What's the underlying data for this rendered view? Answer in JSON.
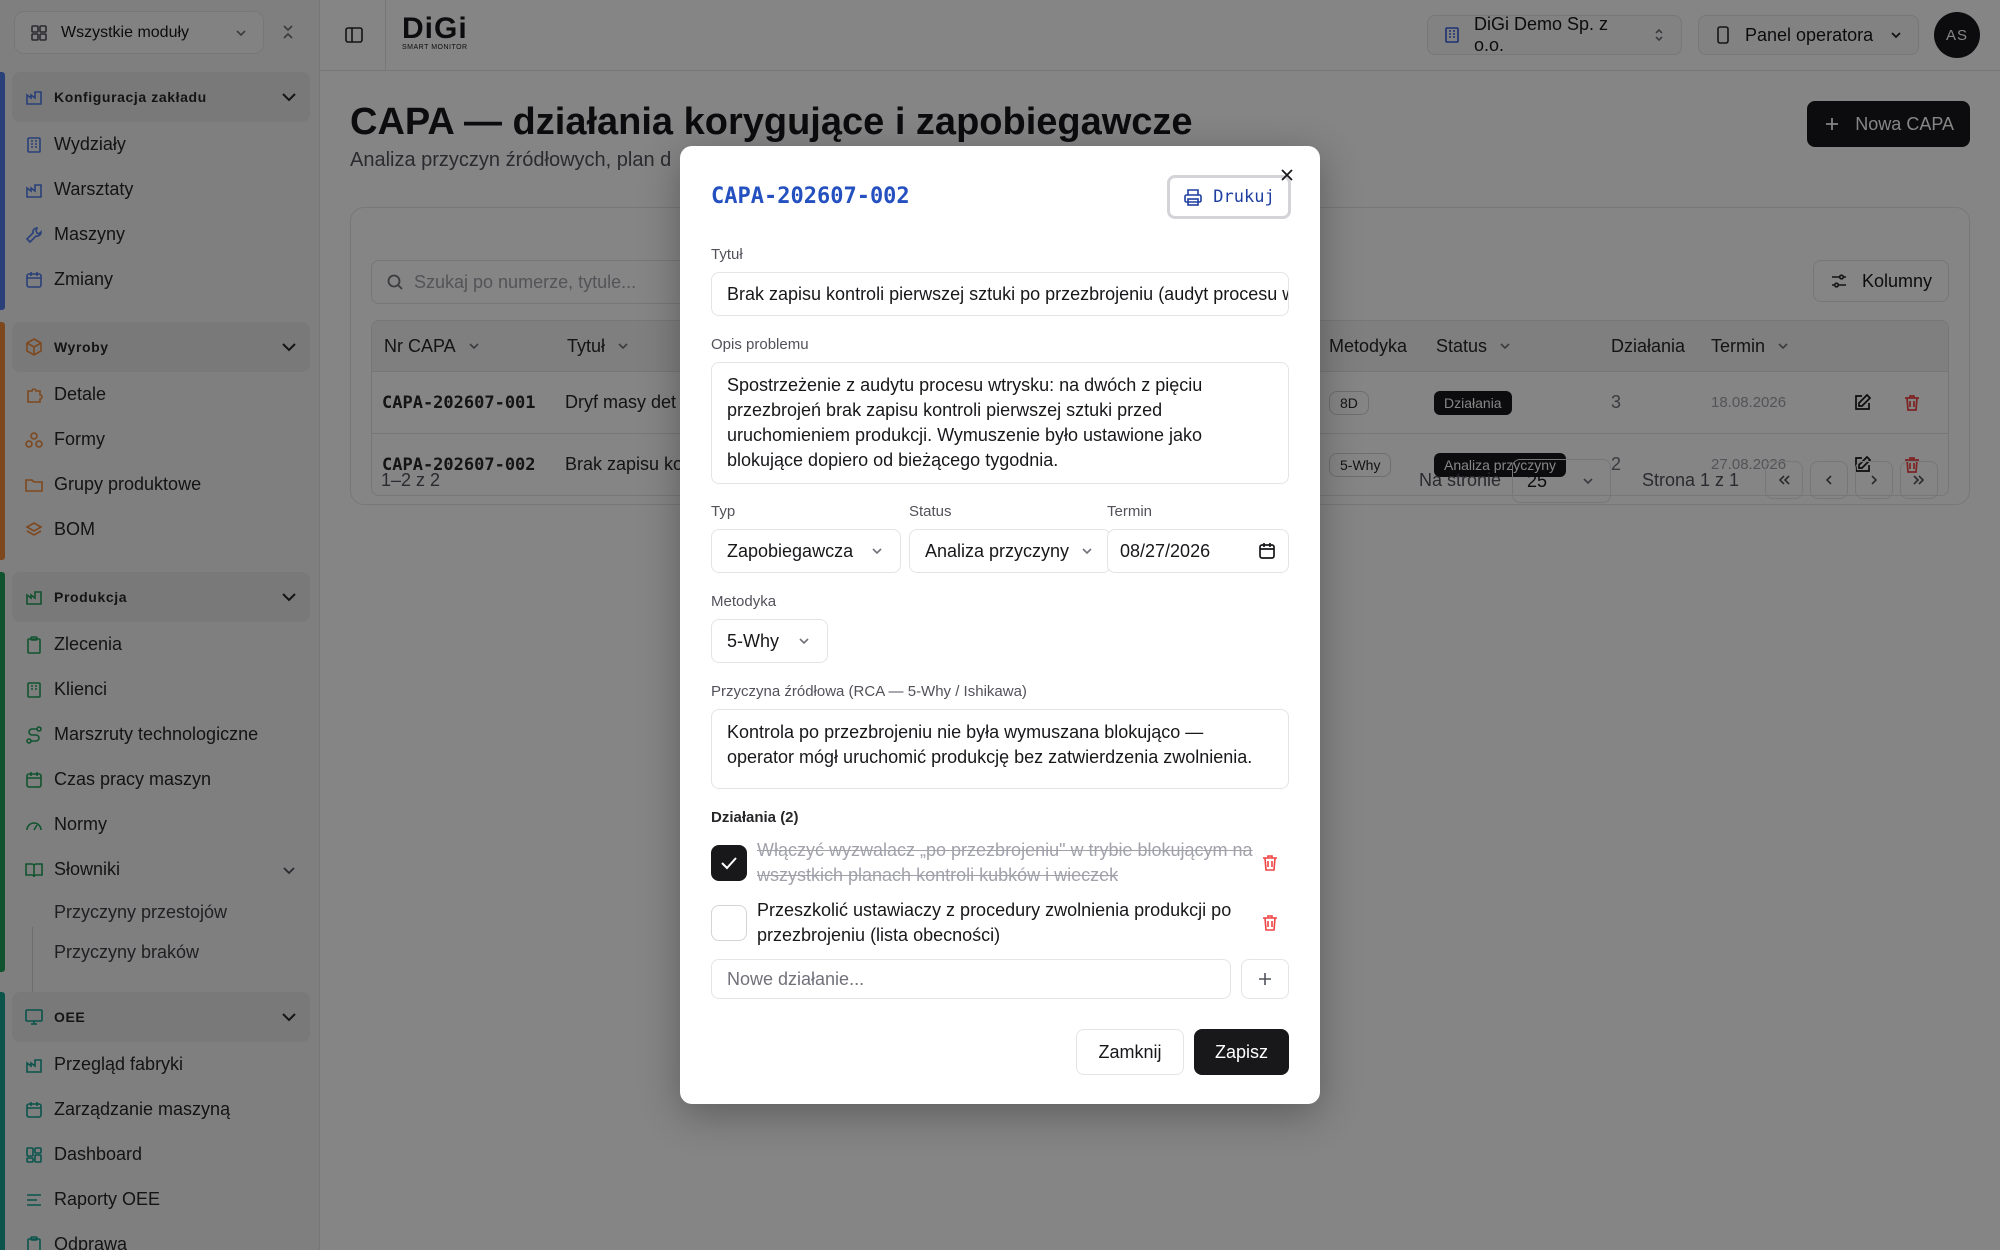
{
  "sidebar": {
    "module_selector": "Wszystkie moduły",
    "groups": [
      {
        "title": "Konfiguracja zakładu",
        "color": "#4f7be8",
        "items": [
          "Wydziały",
          "Warsztaty",
          "Maszyny",
          "Zmiany"
        ]
      },
      {
        "title": "Wyroby",
        "color": "#f08a3a",
        "items": [
          "Detale",
          "Formy",
          "Grupy produktowe",
          "BOM"
        ]
      },
      {
        "title": "Produkcja",
        "color": "#22a05a",
        "items": [
          "Zlecenia",
          "Klienci",
          "Marszruty technologiczne",
          "Czas pracy maszyn",
          "Normy",
          "Słowniki"
        ],
        "subitems": [
          "Przyczyny przestojów",
          "Przyczyny braków"
        ]
      },
      {
        "title": "OEE",
        "color": "#16a090",
        "items": [
          "Przegląd fabryki",
          "Zarządzanie maszyną",
          "Dashboard",
          "Raporty OEE",
          "Odprawa"
        ]
      }
    ]
  },
  "topbar": {
    "logo": "DiGi",
    "logo_sub": "SMART MONITOR",
    "company": "DiGi Demo Sp. z o.o.",
    "panel": "Panel operatora",
    "avatar": "AS"
  },
  "page": {
    "title": "CAPA — działania korygujące i zapobiegawcze",
    "subtitle": "Analiza przyczyn źródłowych, plan d",
    "new_button": "Nowa CAPA",
    "search_placeholder": "Szukaj po numerze, tytule...",
    "columns_button": "Kolumny",
    "table": {
      "headers": {
        "nr": "Nr CAPA",
        "title": "Tytuł",
        "method": "Metodyka",
        "status": "Status",
        "actions": "Działania",
        "due": "Termin"
      },
      "rows": [
        {
          "nr": "CAPA-202607-001",
          "title": "Dryf masy det",
          "method": "8D",
          "status": "Działania",
          "actions": "3",
          "due": "18.08.2026"
        },
        {
          "nr": "CAPA-202607-002",
          "title": "Brak zapisu ko",
          "method": "5-Why",
          "status": "Analiza przyczyny",
          "actions": "2",
          "due": "27.08.2026"
        }
      ]
    },
    "pagination": {
      "range": "1–2 z 2",
      "per_page_label": "Na stronie",
      "per_page": "25",
      "page_info": "Strona 1 z 1"
    }
  },
  "modal": {
    "title": "CAPA-202607-002",
    "print": "Drukuj",
    "title_label": "Tytuł",
    "title_value": "Brak zapisu kontroli pierwszej sztuki po przezbrojeniu (audyt procesu wtrysku)",
    "problem_label": "Opis problemu",
    "problem_value": "Spostrzeżenie z audytu procesu wtrysku: na dwóch z pięciu przezbrojeń brak zapisu kontroli pierwszej sztuki przed uruchomieniem produkcji. Wymuszenie było ustawione jako blokujące dopiero od bieżącego tygodnia.",
    "type_label": "Typ",
    "type_value": "Zapobiegawcza",
    "status_label": "Status",
    "status_value": "Analiza przyczyny",
    "due_label": "Termin",
    "due_value": "08/27/2026",
    "method_label": "Metodyka",
    "method_value": "5-Why",
    "rca_label": "Przyczyna źródłowa (RCA — 5-Why / Ishikawa)",
    "rca_value": "Kontrola po przezbrojeniu nie była wymuszana blokująco — operator mógł uruchomić produkcję bez zatwierdzenia zwolnienia.",
    "actions_label": "Działania (2)",
    "actions": [
      {
        "text": "Włączyć wyzwalacz „po przezbrojeniu\" w trybie blokującym na wszystkich planach kontroli kubków i wieczek",
        "done": true
      },
      {
        "text": "Przeszkolić ustawiaczy z procedury zwolnienia produkcji po przezbrojeniu (lista obecności)",
        "done": false
      }
    ],
    "new_action_placeholder": "Nowe działanie...",
    "close_button": "Zamknij",
    "save_button": "Zapisz"
  },
  "colors": {
    "primary": "#18181b",
    "link": "#2450c0",
    "danger": "#ef4444"
  }
}
